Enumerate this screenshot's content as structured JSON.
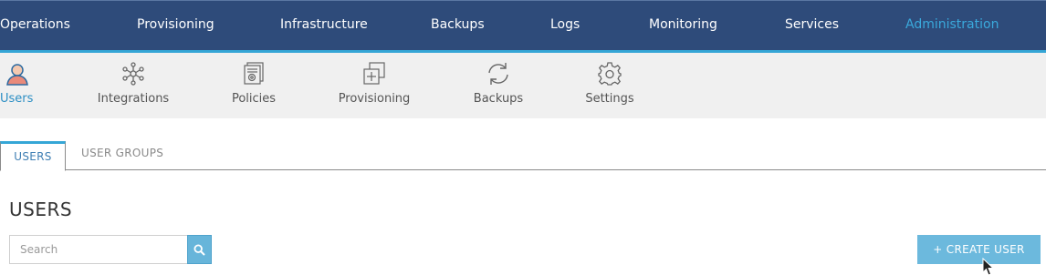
{
  "topnav": {
    "items": [
      {
        "label": "Operations"
      },
      {
        "label": "Provisioning"
      },
      {
        "label": "Infrastructure"
      },
      {
        "label": "Backups"
      },
      {
        "label": "Logs"
      },
      {
        "label": "Monitoring"
      },
      {
        "label": "Services"
      },
      {
        "label": "Administration",
        "active": true
      }
    ]
  },
  "subnav": {
    "items": [
      {
        "label": "Users",
        "icon": "user-icon",
        "active": true
      },
      {
        "label": "Integrations",
        "icon": "integrations-icon"
      },
      {
        "label": "Policies",
        "icon": "policies-icon"
      },
      {
        "label": "Provisioning",
        "icon": "provisioning-icon"
      },
      {
        "label": "Backups",
        "icon": "backups-refresh-icon"
      },
      {
        "label": "Settings",
        "icon": "gear-icon"
      }
    ]
  },
  "tabs": {
    "items": [
      {
        "label": "USERS",
        "active": true
      },
      {
        "label": "USER GROUPS"
      }
    ]
  },
  "main": {
    "title": "USERS",
    "search": {
      "placeholder": "Search",
      "value": ""
    },
    "create_label": "+ CREATE USER"
  },
  "colors": {
    "nav_bg": "#2e4b7a",
    "accent": "#35a6d6",
    "button": "#6cb9dd"
  }
}
